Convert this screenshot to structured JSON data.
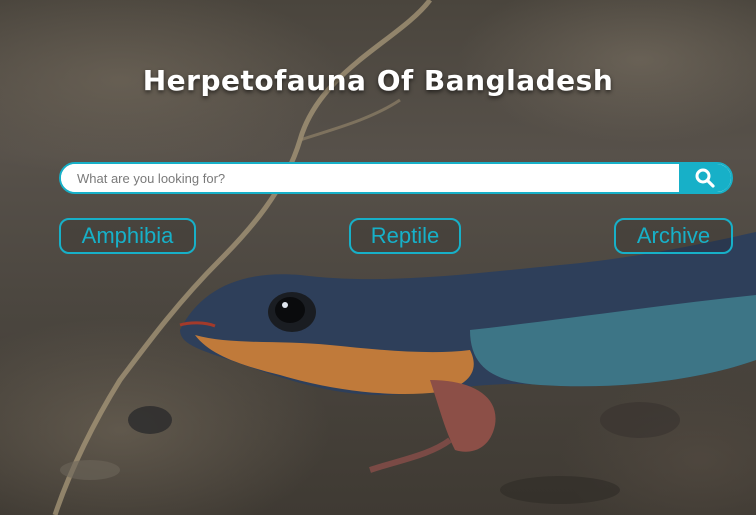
{
  "header": {
    "title": "Herpetofauna Of Bangladesh"
  },
  "search": {
    "placeholder": "What are you looking for?",
    "value": ""
  },
  "categories": [
    {
      "label": "Amphibia"
    },
    {
      "label": "Reptile"
    },
    {
      "label": "Archive"
    }
  ],
  "colors": {
    "accent": "#17b0c8",
    "title_text": "#ffffff"
  },
  "icons": {
    "search": "search-icon"
  }
}
